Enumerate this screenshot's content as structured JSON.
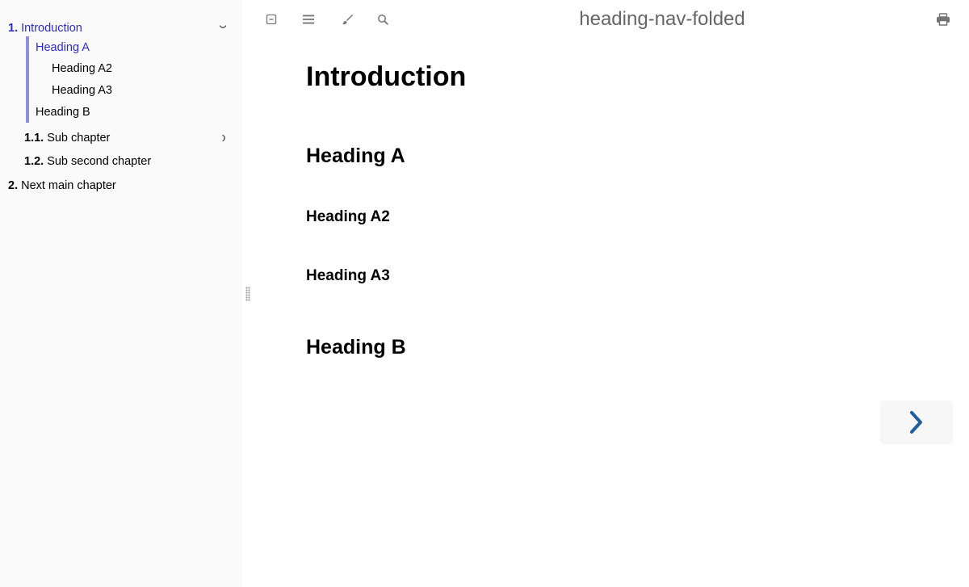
{
  "sidebar": {
    "items": [
      {
        "num": "1.",
        "label": "Introduction"
      },
      {
        "label": "Heading A"
      },
      {
        "label": "Heading A2"
      },
      {
        "label": "Heading A3"
      },
      {
        "label": "Heading B"
      },
      {
        "num": "1.1.",
        "label": "Sub chapter"
      },
      {
        "num": "1.2.",
        "label": "Sub second chapter"
      },
      {
        "num": "2.",
        "label": "Next main chapter"
      }
    ]
  },
  "header": {
    "title": "heading-nav-folded",
    "icons": [
      "sidebar-toggle-icon",
      "menu-icon",
      "theme-brush-icon",
      "search-icon",
      "print-icon"
    ]
  },
  "main": {
    "headings": [
      "Introduction",
      "Heading A",
      "Heading A2",
      "Heading A3",
      "Heading B"
    ]
  },
  "colors": {
    "active_link": "#2b2bd6",
    "sidebar_bg": "#fafafa",
    "active_bar": "#8f8fe0",
    "nav_arrow": "#1f5fa0",
    "icon_gray": "#747474"
  }
}
